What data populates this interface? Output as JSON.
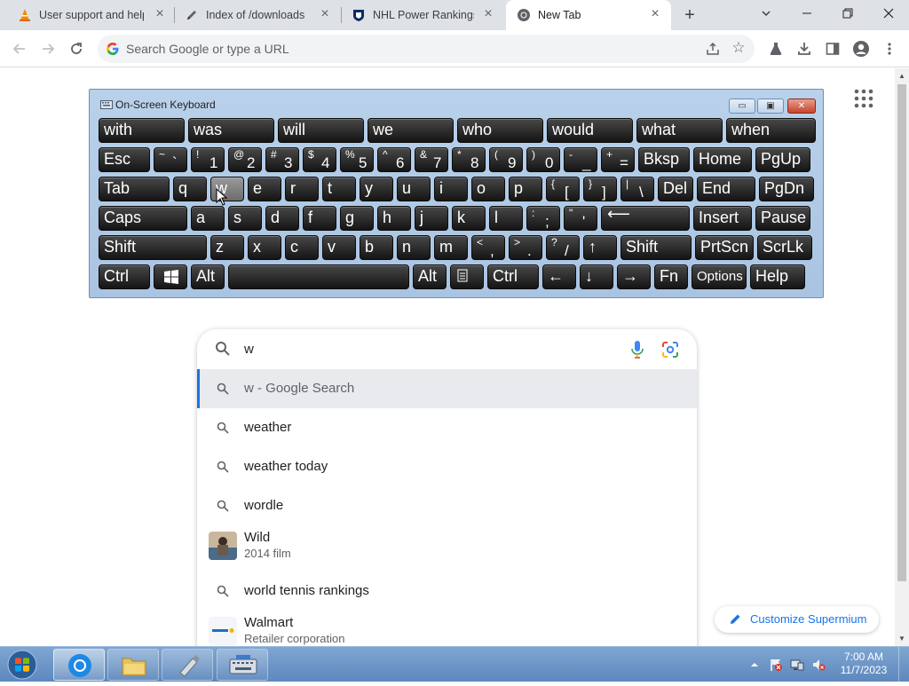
{
  "browser": {
    "tabs": [
      {
        "title": "User support and help",
        "icon": "vlc-cone-icon",
        "active": false
      },
      {
        "title": "Index of /downloads",
        "icon": "pen-icon",
        "active": false
      },
      {
        "title": "NHL Power Rankings: ",
        "icon": "nhl-shield-icon",
        "active": false
      },
      {
        "title": "New Tab",
        "icon": "chrome-icon",
        "active": true
      }
    ],
    "new_tab_label": "+",
    "window_controls": {
      "dropdown": "⌄",
      "minimize": "—",
      "restore": "❐",
      "close": "✕"
    },
    "omnibox": {
      "placeholder": "Search Google or type a URL"
    }
  },
  "osk": {
    "title": "On-Screen Keyboard",
    "rows": [
      [
        "with",
        "was",
        "will",
        "we",
        "who",
        "would",
        "what",
        "when"
      ],
      [
        "Esc",
        "~ `",
        "! 1",
        "@ 2",
        "# 3",
        "$ 4",
        "% 5",
        "^ 6",
        "& 7",
        "* 8",
        "( 9",
        ") 0",
        "- _",
        "+ =",
        "Bksp",
        "Home",
        "PgUp"
      ],
      [
        "Tab",
        "q",
        "w",
        "e",
        "r",
        "t",
        "y",
        "u",
        "i",
        "o",
        "p",
        "{ [",
        "} ]",
        "| \\",
        "Del",
        "End",
        "PgDn"
      ],
      [
        "Caps",
        "a",
        "s",
        "d",
        "f",
        "g",
        "h",
        "j",
        "k",
        "l",
        ": ;",
        "\" '",
        "⟵",
        "Insert",
        "Pause"
      ],
      [
        "Shift",
        "z",
        "x",
        "c",
        "v",
        "b",
        "n",
        "m",
        "< ,",
        "> .",
        "? /",
        "↑",
        "Shift",
        "PrtScn",
        "ScrLk"
      ],
      [
        "Ctrl",
        "win-logo",
        "Alt",
        "",
        "Alt",
        "menu",
        "Ctrl",
        "←",
        "↓",
        "→",
        "Fn",
        "Options",
        "Help"
      ]
    ]
  },
  "search": {
    "query": "w",
    "suggestions": [
      {
        "text": "w - Google Search",
        "type": "search",
        "selected": true
      },
      {
        "text": "weather",
        "type": "search"
      },
      {
        "text": "weather today",
        "type": "search"
      },
      {
        "text": "wordle",
        "type": "search"
      },
      {
        "text": "Wild",
        "subtitle": "2014 film",
        "type": "entity",
        "icon": "film-thumbnail"
      },
      {
        "text": "world tennis rankings",
        "type": "search"
      },
      {
        "text": "Walmart",
        "subtitle": "Retailer corporation",
        "type": "entity",
        "icon": "walmart-logo"
      }
    ]
  },
  "customize": {
    "label": "Customize Supermium"
  },
  "taskbar": {
    "apps": [
      "chrome-icon",
      "file-explorer-icon",
      "usb-drive-icon",
      "on-screen-keyboard-icon"
    ],
    "clock": {
      "time": "7:00 AM",
      "date": "11/7/2023"
    }
  }
}
